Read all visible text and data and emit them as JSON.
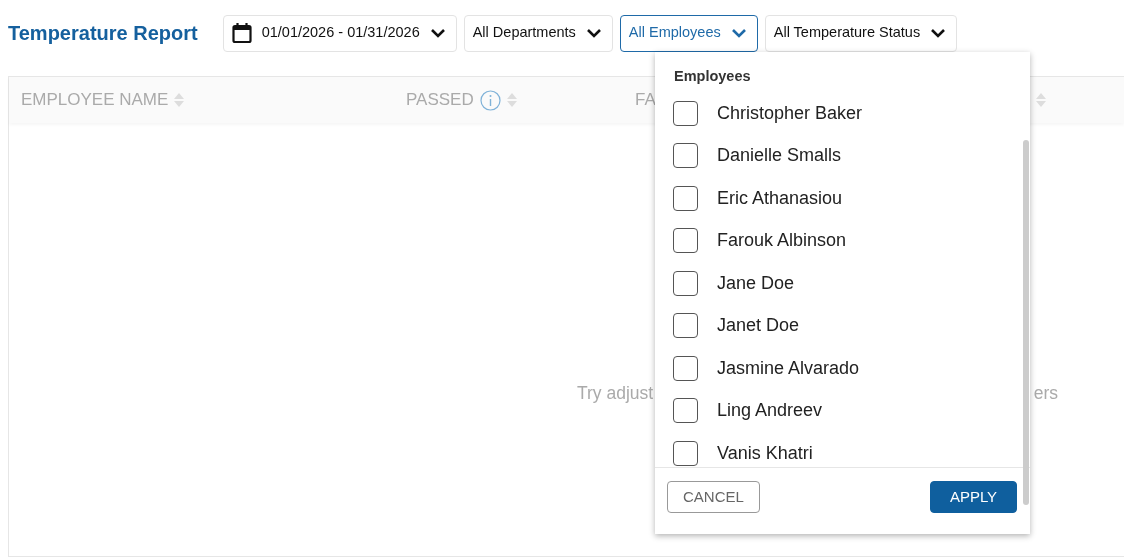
{
  "title": "Temperature Report",
  "filters": [
    {
      "kind": "date",
      "label": "01/01/2026 - 01/31/2026",
      "active": false
    },
    {
      "kind": "select",
      "label": "All Departments",
      "active": false
    },
    {
      "kind": "select",
      "label": "All Employees",
      "active": true
    },
    {
      "kind": "select",
      "label": "All Temperature Status",
      "active": false
    }
  ],
  "table": {
    "columns": [
      {
        "label": "EMPLOYEE NAME",
        "info": false,
        "sortable": true
      },
      {
        "label": "PASSED",
        "info": true,
        "sortable": true
      },
      {
        "label": "FA",
        "info": false
      },
      {
        "sortable": true
      }
    ],
    "empty_message": [
      "Try adjust",
      "ers"
    ]
  },
  "dropdown": {
    "heading": "Employees",
    "items": [
      {
        "label": "Christopher Baker",
        "checked": false
      },
      {
        "label": "Danielle Smalls",
        "checked": false
      },
      {
        "label": "Eric Athanasiou",
        "checked": false
      },
      {
        "label": "Farouk Albinson",
        "checked": false
      },
      {
        "label": "Jane Doe",
        "checked": false
      },
      {
        "label": "Janet Doe",
        "checked": false
      },
      {
        "label": "Jasmine Alvarado",
        "checked": false
      },
      {
        "label": "Ling Andreev",
        "checked": false
      },
      {
        "label": "Vanis Khatri",
        "checked": false
      }
    ],
    "buttons": [
      {
        "kind": "secondary",
        "label": "CANCEL"
      },
      {
        "kind": "primary",
        "label": "APPLY"
      }
    ]
  }
}
